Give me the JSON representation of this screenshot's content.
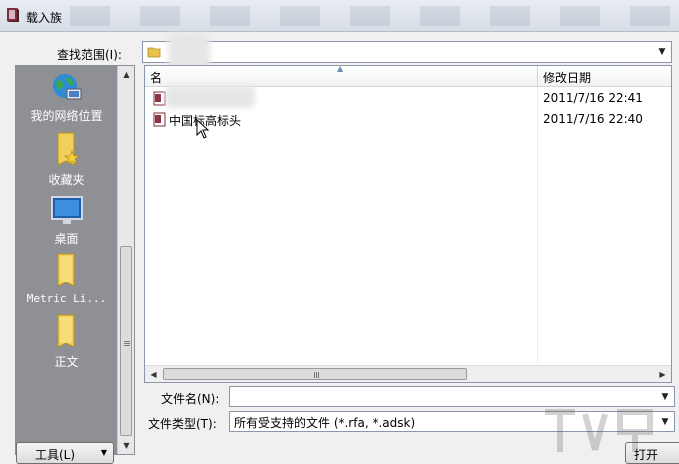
{
  "window": {
    "title": "载入族"
  },
  "look_in": {
    "label": "查找范围(I):",
    "value": ""
  },
  "places": [
    {
      "label": "我的网络位置",
      "icon": "network-globe-icon"
    },
    {
      "label": "收藏夹",
      "icon": "favorites-folder-icon"
    },
    {
      "label": "桌面",
      "icon": "desktop-icon"
    },
    {
      "label": "Metric Li...",
      "icon": "folder-icon"
    },
    {
      "label": "正文",
      "icon": "folder-icon"
    }
  ],
  "file_list": {
    "columns": {
      "name": "名",
      "date": "修改日期"
    },
    "rows": [
      {
        "name": "",
        "date": "2011/7/16 22:41"
      },
      {
        "name": "中国标高标头",
        "date": "2011/7/16 22:40"
      }
    ]
  },
  "file_name": {
    "label": "文件名(N):",
    "value": ""
  },
  "file_type": {
    "label": "文件类型(T):",
    "value": "所有受支持的文件 (*.rfa, *.adsk)"
  },
  "buttons": {
    "tools": "工具(L)",
    "open": "打开"
  }
}
